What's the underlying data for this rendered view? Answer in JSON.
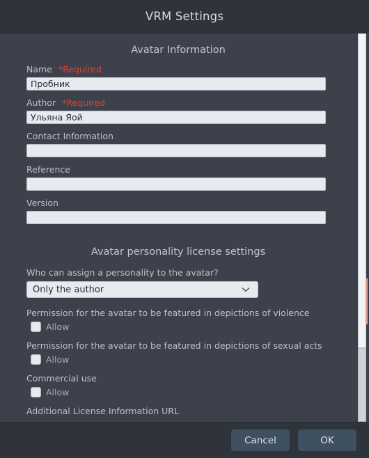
{
  "titlebar": {
    "title": "VRM Settings"
  },
  "avatar_info": {
    "heading": "Avatar Information",
    "fields": [
      {
        "label": "Name",
        "required": "*Required",
        "value": "Пробник"
      },
      {
        "label": "Author",
        "required": "*Required",
        "value": "Ульяна Яой"
      },
      {
        "label": "Contact Information",
        "required": "",
        "value": ""
      },
      {
        "label": "Reference",
        "required": "",
        "value": ""
      },
      {
        "label": "Version",
        "required": "",
        "value": ""
      }
    ]
  },
  "license": {
    "heading": "Avatar personality license settings",
    "assign_question": "Who can assign a personality to the avatar?",
    "assign_value": "Only the author",
    "chevron_icon": "chevron-down-icon",
    "permissions": [
      {
        "caption": "Permission for the avatar to be featured in depictions of violence",
        "allow_label": "Allow",
        "checked": false
      },
      {
        "caption": "Permission for the avatar to be featured in depictions of sexual acts",
        "allow_label": "Allow",
        "checked": false
      },
      {
        "caption": "Commercial use",
        "allow_label": "Allow",
        "checked": false
      }
    ],
    "clipped_label": "Additional License Information URL"
  },
  "footer": {
    "cancel_label": "Cancel",
    "ok_label": "OK"
  },
  "colors": {
    "titlebar_bg": "#2f333a",
    "content_bg": "#3c414b",
    "input_bg": "#e7eaef",
    "required_red": "#e8402a",
    "button_bg": "#3f5060",
    "label_text": "#bcc1c8"
  }
}
